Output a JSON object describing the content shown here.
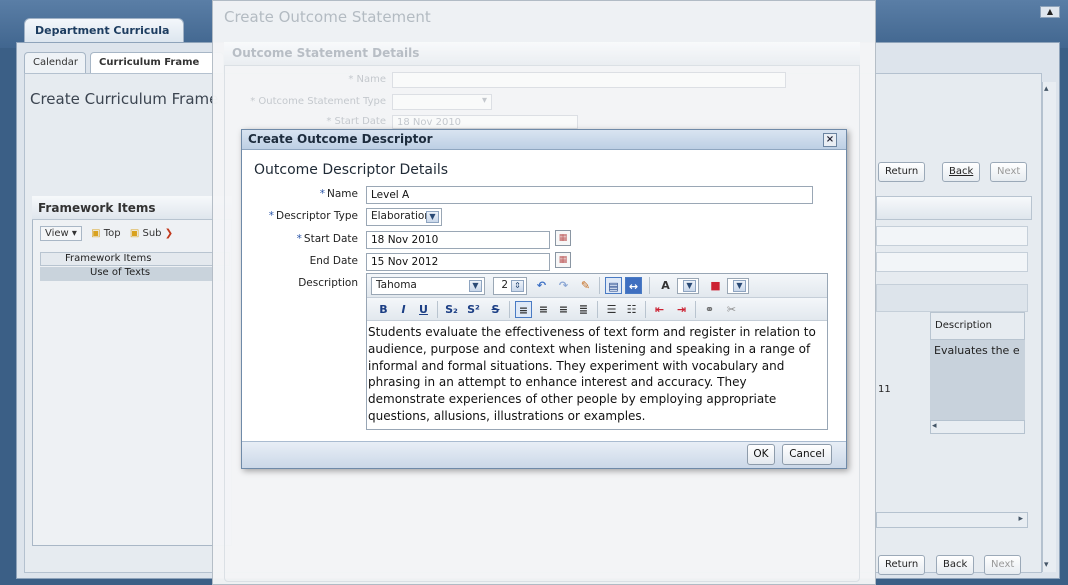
{
  "background": {
    "dept_tab": "Department Curricula",
    "subtabs": [
      "Calendar",
      "Curriculum Frame"
    ],
    "page_title": "Create Curriculum Frame",
    "framework_items": {
      "title": "Framework Items",
      "toolbar": {
        "view": "View",
        "top": "Top",
        "sub": "Sub"
      },
      "list_header": "Framework Items",
      "list_item": "Use of Texts"
    },
    "buttons_top": {
      "return": "Return",
      "back": "Back",
      "next": "Next"
    },
    "buttons_bottom": {
      "return": "Return",
      "back": "Back",
      "next": "Next"
    },
    "table": {
      "col_header": "Description",
      "cell": "Evaluates the e",
      "side_num": "11"
    }
  },
  "mid_dialog": {
    "title": "Create Outcome Statement",
    "section_title": "Outcome Statement Details",
    "fields": {
      "name_label": "* Name",
      "type_label": "* Outcome Statement Type",
      "start_label": "* Start Date",
      "start_value": "18 Nov 2010"
    }
  },
  "dialog": {
    "title": "Create Outcome Descriptor",
    "close": "×",
    "section_title": "Outcome Descriptor Details",
    "fields": {
      "name_label": "Name",
      "name_value": "Level A",
      "type_label": "Descriptor Type",
      "type_value": "Elaboration",
      "start_label": "Start Date",
      "start_value": "18 Nov 2010",
      "end_label": "End Date",
      "end_value": "15 Nov 2012",
      "desc_label": "Description"
    },
    "editor": {
      "font": "Tahoma",
      "size": "2",
      "text": "Students evaluate the effectiveness of text form and register in relation to audience, purpose and context when listening and speaking in a range of informal and formal situations. They experiment with vocabulary and phrasing in an attempt to enhance interest and accuracy. They demonstrate experiences of other people by employing appropriate questions, allusions, illustrations or examples."
    },
    "ok": "OK",
    "cancel": "Cancel"
  },
  "colors": {
    "accent": "#2a55a8",
    "titlebar": "#bdcfe4",
    "app_header": "#41668f"
  }
}
